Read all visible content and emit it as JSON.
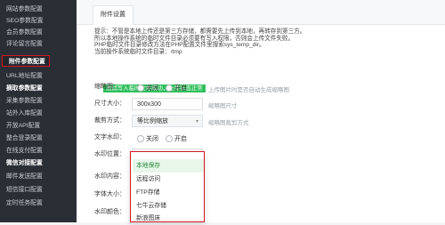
{
  "sidebar": {
    "items": [
      {
        "label": "网站参数配置"
      },
      {
        "label": "SEO参数配置"
      },
      {
        "label": "会员参数配置"
      },
      {
        "label": "评论留言配置"
      },
      {
        "label": "附件参数配置"
      },
      {
        "label": "URL地址配置"
      },
      {
        "label": "摘取参数配置"
      },
      {
        "label": "采集参数配置"
      },
      {
        "label": "站外入库配置"
      },
      {
        "label": "开放API配置"
      },
      {
        "label": "整合登录配置"
      },
      {
        "label": "在线支付配置"
      },
      {
        "label": "微信对接配置"
      },
      {
        "label": "邮件发送配置"
      },
      {
        "label": "短信接口配置"
      },
      {
        "label": "定时任务配置"
      }
    ]
  },
  "tab": {
    "label": "附件设置"
  },
  "hint": {
    "lines": [
      "提示：不管是本地上传还是第三方存储，都需要先上传到本地，再转存到第三方。",
      "所以本地操作系统的临时文件目录必须要有写入权限，否则会上传文件失败。",
      "PHP临时文件目录修改方法在PHP配置文件里搜索sys_temp_dir。",
      "当前操作系统临时文件目录：/tmp"
    ],
    "badge": "测试写入临时文件成功，上传状态正常"
  },
  "form": {
    "thumb": {
      "label": "缩略图：",
      "off": "关闭",
      "on": "开启",
      "help": "上传图片时是否自动生成缩略图"
    },
    "size": {
      "label": "尺寸大小：",
      "value": "300x300",
      "help": "缩略图尺寸"
    },
    "crop": {
      "label": "裁剪方式：",
      "value": "等比例缩放",
      "help": "缩略图裁剪方式"
    },
    "watermark": {
      "label": "文字水印：",
      "off": "关闭",
      "on": "开启"
    },
    "pos": {
      "label": "水印位置："
    },
    "content": {
      "label": "水印内容："
    },
    "fontsize": {
      "label": "字体大小："
    },
    "color": {
      "label": "水印颜色："
    }
  },
  "dropdown": {
    "options": [
      "本地保存",
      "远程访问",
      "FTP存储",
      "七牛云存储",
      "新浪图床"
    ],
    "selected": "本地保存"
  }
}
